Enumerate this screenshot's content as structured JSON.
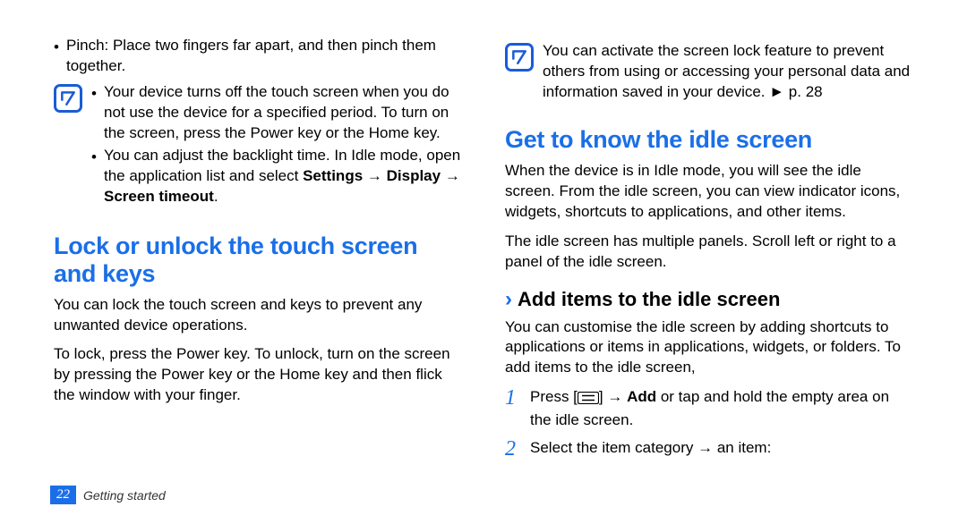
{
  "left": {
    "pinch": "Pinch: Place two fingers far apart, and then pinch them together.",
    "note_bullet1": "Your device turns off the touch screen when you do not use the device for a specified period. To turn on the screen, press the Power key or the Home key.",
    "note_bullet2_pre": "You can adjust the backlight time. In Idle mode, open the application list and select ",
    "note_bullet2_settings": "Settings",
    "note_bullet2_arrow1": " → ",
    "note_bullet2_display": "Display",
    "note_bullet2_arrow2": " → ",
    "note_bullet2_timeout": "Screen timeout",
    "note_bullet2_period": ".",
    "h2": "Lock or unlock the touch screen and keys",
    "p1": "You can lock the touch screen and keys to prevent any unwanted device operations.",
    "p2": "To lock, press the Power key. To unlock, turn on the screen by pressing the Power key or the Home key and then flick the window with your finger."
  },
  "right": {
    "note": "You can activate the screen lock feature to prevent others from using or accessing your personal data and information saved in your device. ► p. 28",
    "h2": "Get to know the idle screen",
    "p1": "When the device is in Idle mode, you will see the idle screen. From the idle screen, you can view indicator icons, widgets, shortcuts to applications, and other items.",
    "p2": "The idle screen has multiple panels. Scroll left or right to a panel of the idle screen.",
    "h3": "Add items to the idle screen",
    "p3": "You can customise the idle screen by adding shortcuts to applications or items in applications, widgets, or folders. To add items to the idle screen,",
    "step1_pre": "Press [",
    "step1_post1": "] → ",
    "step1_add": "Add",
    "step1_post2": " or tap and hold the empty area on the idle screen.",
    "step2": "Select the item category → an item:"
  },
  "footer": {
    "page": "22",
    "section": "Getting started"
  }
}
